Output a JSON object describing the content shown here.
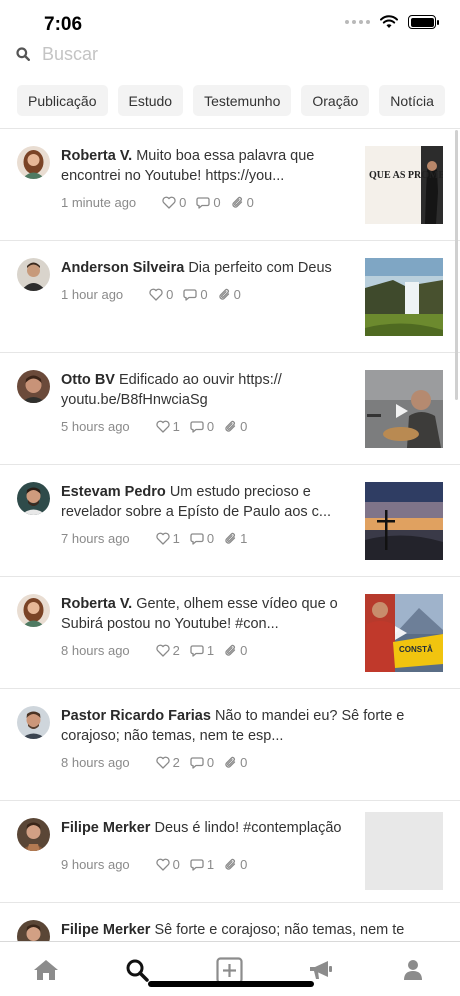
{
  "status_bar": {
    "time": "7:06"
  },
  "search": {
    "placeholder": "Buscar"
  },
  "categories": [
    "Publicação",
    "Estudo",
    "Testemunho",
    "Oração",
    "Notícia"
  ],
  "posts": [
    {
      "author": "Roberta V.",
      "text": "Muito boa essa palavra que encontrei no Youtube! https://you...",
      "time": "1 minute ago",
      "likes": "0",
      "comments": "0",
      "attachments": "0"
    },
    {
      "author": "Anderson Silveira",
      "text": "Dia perfeito com Deus",
      "time": "1 hour ago",
      "likes": "0",
      "comments": "0",
      "attachments": "0"
    },
    {
      "author": "Otto BV",
      "text": "Edificado ao ouvir https:// youtu.be/B8fHnwciaSg",
      "time": "5 hours ago",
      "likes": "1",
      "comments": "0",
      "attachments": "0"
    },
    {
      "author": "Estevam Pedro",
      "text": "Um estudo precioso e revelador sobre a Epísto de Paulo aos c...",
      "time": "7 hours ago",
      "likes": "1",
      "comments": "0",
      "attachments": "1"
    },
    {
      "author": "Roberta V.",
      "text": "Gente, olhem esse vídeo que o Subirá postou no Youtube! #con...",
      "time": "8 hours ago",
      "likes": "2",
      "comments": "1",
      "attachments": "0"
    },
    {
      "author": "Pastor Ricardo Farias",
      "text": "Não to mandei eu? Sê forte e corajoso; não temas, nem te esp...",
      "time": "8 hours ago",
      "likes": "2",
      "comments": "0",
      "attachments": "0"
    },
    {
      "author": "Filipe Merker",
      "text": "Deus é lindo! #contemplação",
      "time": "9 hours ago",
      "likes": "0",
      "comments": "1",
      "attachments": "0"
    },
    {
      "author": "Filipe Merker",
      "text": "Sê forte e corajoso; não temas, nem te"
    }
  ],
  "thumbnails": {
    "post0_text": "QUE AS PROMESSAS TE CUMPRAM"
  },
  "colors": {
    "accent": "#1a1a1a",
    "tab_inactive": "#8c8c8c",
    "meta_text": "#8a8a8a"
  },
  "tabbar": [
    "home-icon",
    "search-icon",
    "add-post-icon",
    "megaphone-icon",
    "profile-icon"
  ]
}
